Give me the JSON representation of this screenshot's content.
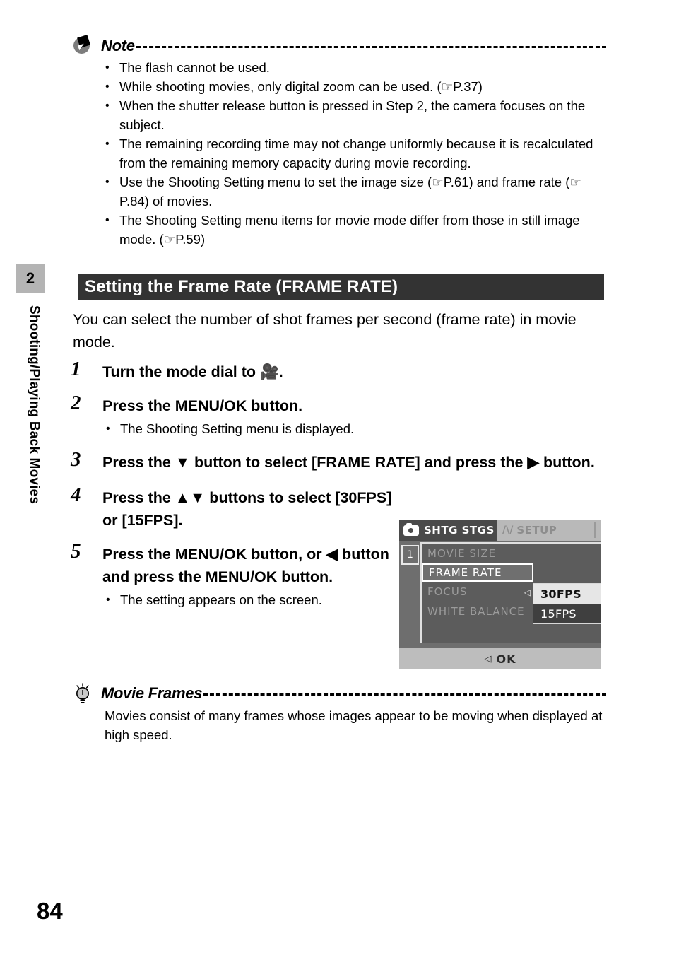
{
  "chapter": {
    "number": "2",
    "vertical_label": "Shooting/Playing Back Movies"
  },
  "note": {
    "title": "Note",
    "icon": "note-icon",
    "bullets": [
      "The flash cannot be used.",
      "While shooting movies, only digital zoom can be used. (☞P.37)",
      "When the shutter release button is pressed in Step 2, the camera focuses on the subject.",
      "The remaining recording time may not change uniformly because it is recalculated from the remaining memory capacity during movie recording.",
      "Use the Shooting Setting menu to set the image size (☞P.61) and frame rate (☞P.84) of movies.",
      "The Shooting Setting menu items for movie mode differ from those in still image mode. (☞P.59)"
    ]
  },
  "section": {
    "heading": "Setting the Frame Rate (FRAME RATE)",
    "heading_bg": "#333333",
    "intro": "You can select the number of shot frames per second (frame rate) in movie mode."
  },
  "steps": [
    {
      "number": "1",
      "text": "Turn the mode dial to 🎥.",
      "sub": ""
    },
    {
      "number": "2",
      "text": "Press the MENU/OK button.",
      "sub": "The Shooting Setting menu is displayed."
    },
    {
      "number": "3",
      "text": "Press the ▼ button to select [FRAME RATE] and press the ▶ button.",
      "sub": ""
    },
    {
      "number": "4",
      "text": "Press the ▲▼ buttons to select [30FPS] or [15FPS].",
      "sub": ""
    },
    {
      "number": "5",
      "text": "Press the MENU/OK button, or ◀ button and press the MENU/OK button.",
      "sub": "The setting appears on the screen."
    }
  ],
  "lcd": {
    "tab_active": "SHTG STGS",
    "tab_inactive": "SETUP",
    "tab_inactive_icon": "wrench-icon",
    "page_indicator": "1",
    "menu_items": [
      "MOVIE SIZE",
      "FRAME RATE",
      "FOCUS",
      "WHITE BALANCE"
    ],
    "selected_item": "FRAME RATE",
    "submenu": [
      "30FPS",
      "15FPS"
    ],
    "submenu_selected": "30FPS",
    "footer_label": "OK",
    "footer_glyph": "◁"
  },
  "tip": {
    "title": "Movie Frames",
    "icon": "lightbulb-icon",
    "text": "Movies consist of many frames whose images appear to be moving when displayed at high speed."
  },
  "footer": {
    "page_number": "84"
  }
}
